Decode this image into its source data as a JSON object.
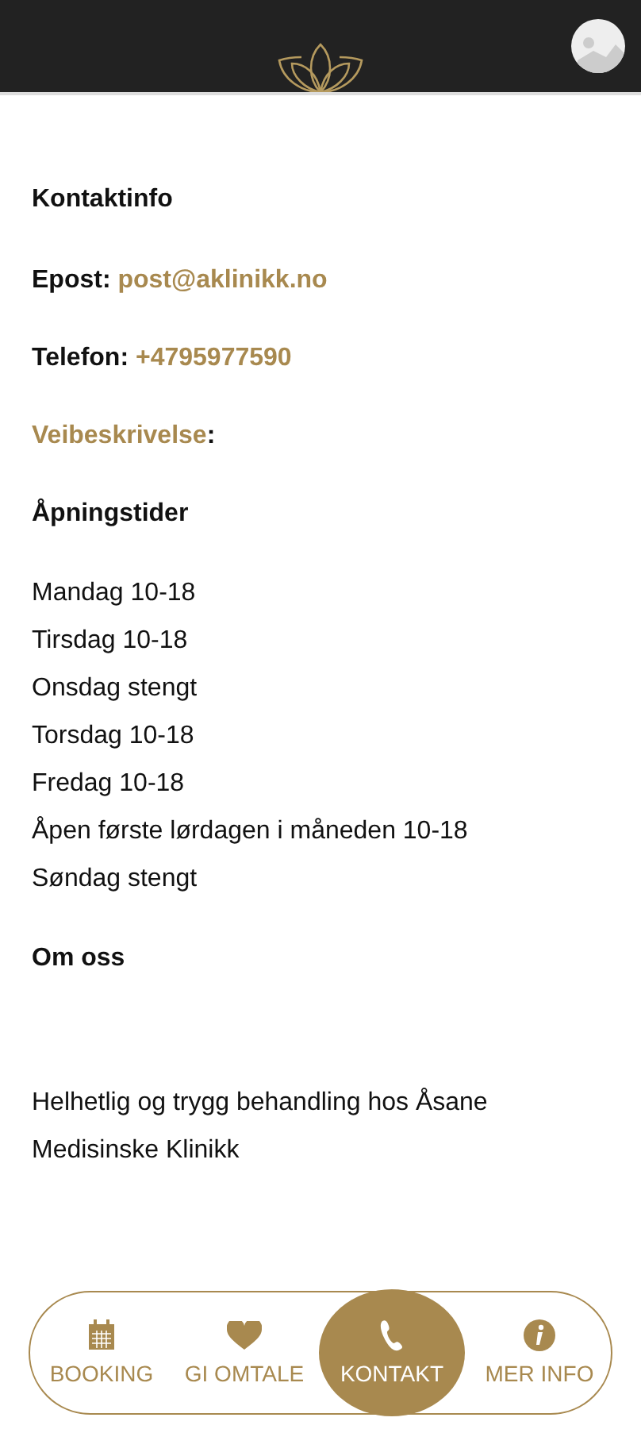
{
  "header": {
    "avatar": true
  },
  "contact": {
    "heading": "Kontaktinfo",
    "items": [
      {
        "kind": "label-first",
        "label": "Epost:",
        "link": "post@aklinikk.no"
      },
      {
        "kind": "label-first",
        "label": "Telefon:",
        "link": "+4795977590"
      },
      {
        "kind": "link-first",
        "link": "Veibeskrivelse",
        "label": ":"
      }
    ]
  },
  "hours": {
    "heading": "Åpningstider",
    "lines": [
      "Mandag 10-18",
      "Tirsdag 10-18",
      "Onsdag stengt",
      "Torsdag 10-18",
      "Fredag 10-18",
      "Åpen første lørdagen i måneden 10-18",
      "Søndag stengt"
    ]
  },
  "about": {
    "heading": "Om oss",
    "paragraph": "Helhetlig og trygg behandling hos Åsane Medisinske Klinikk"
  },
  "nav": [
    {
      "kind": "calendar",
      "label": "BOOKING",
      "selected": false
    },
    {
      "kind": "heart",
      "label": "GI OMTALE",
      "selected": false
    },
    {
      "kind": "phone",
      "label": "KONTAKT",
      "selected": true
    },
    {
      "kind": "info",
      "label": "MER INFO",
      "selected": false
    }
  ]
}
